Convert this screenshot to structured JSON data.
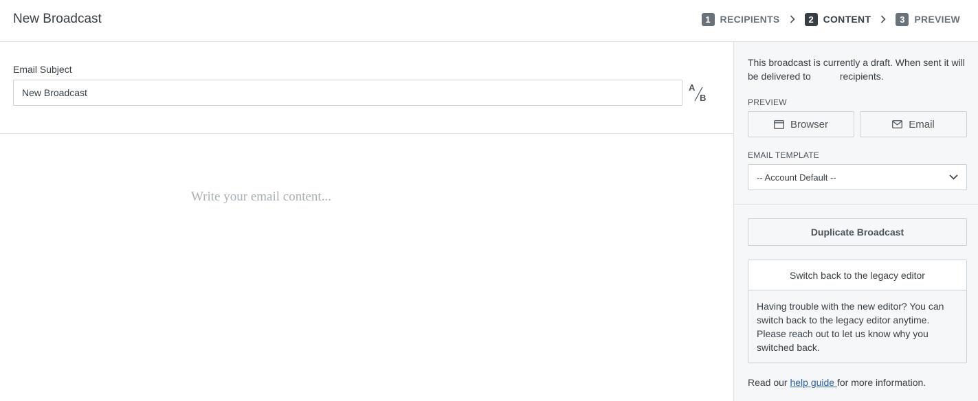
{
  "header": {
    "title": "New Broadcast",
    "steps": [
      {
        "number": "1",
        "label": "RECIPIENTS",
        "active": false
      },
      {
        "number": "2",
        "label": "CONTENT",
        "active": true
      },
      {
        "number": "3",
        "label": "PREVIEW",
        "active": false
      }
    ]
  },
  "subject": {
    "label": "Email Subject",
    "value": "New Broadcast",
    "ab_a": "A",
    "ab_b": "B"
  },
  "editor": {
    "placeholder": "Write your email content..."
  },
  "sidebar": {
    "draft_note_before": "This broadcast is currently a draft. When sent it will be delivered to",
    "draft_note_after": "recipients.",
    "preview_label": "PREVIEW",
    "browser_label": "Browser",
    "email_label": "Email",
    "template_label": "EMAIL TEMPLATE",
    "template_value": "-- Account Default --",
    "duplicate_label": "Duplicate Broadcast",
    "legacy_button": "Switch back to the legacy editor",
    "legacy_text": "Having trouble with the new editor? You can switch back to the legacy editor anytime. Please reach out to let us know why you switched back.",
    "help_prefix": "Read our ",
    "help_link": "help guide ",
    "help_suffix": "for more information."
  },
  "icons": {
    "browser": "browser-window-icon",
    "email": "envelope-icon",
    "chevron": "chevron-right-icon",
    "dropdown": "chevron-down-icon"
  }
}
